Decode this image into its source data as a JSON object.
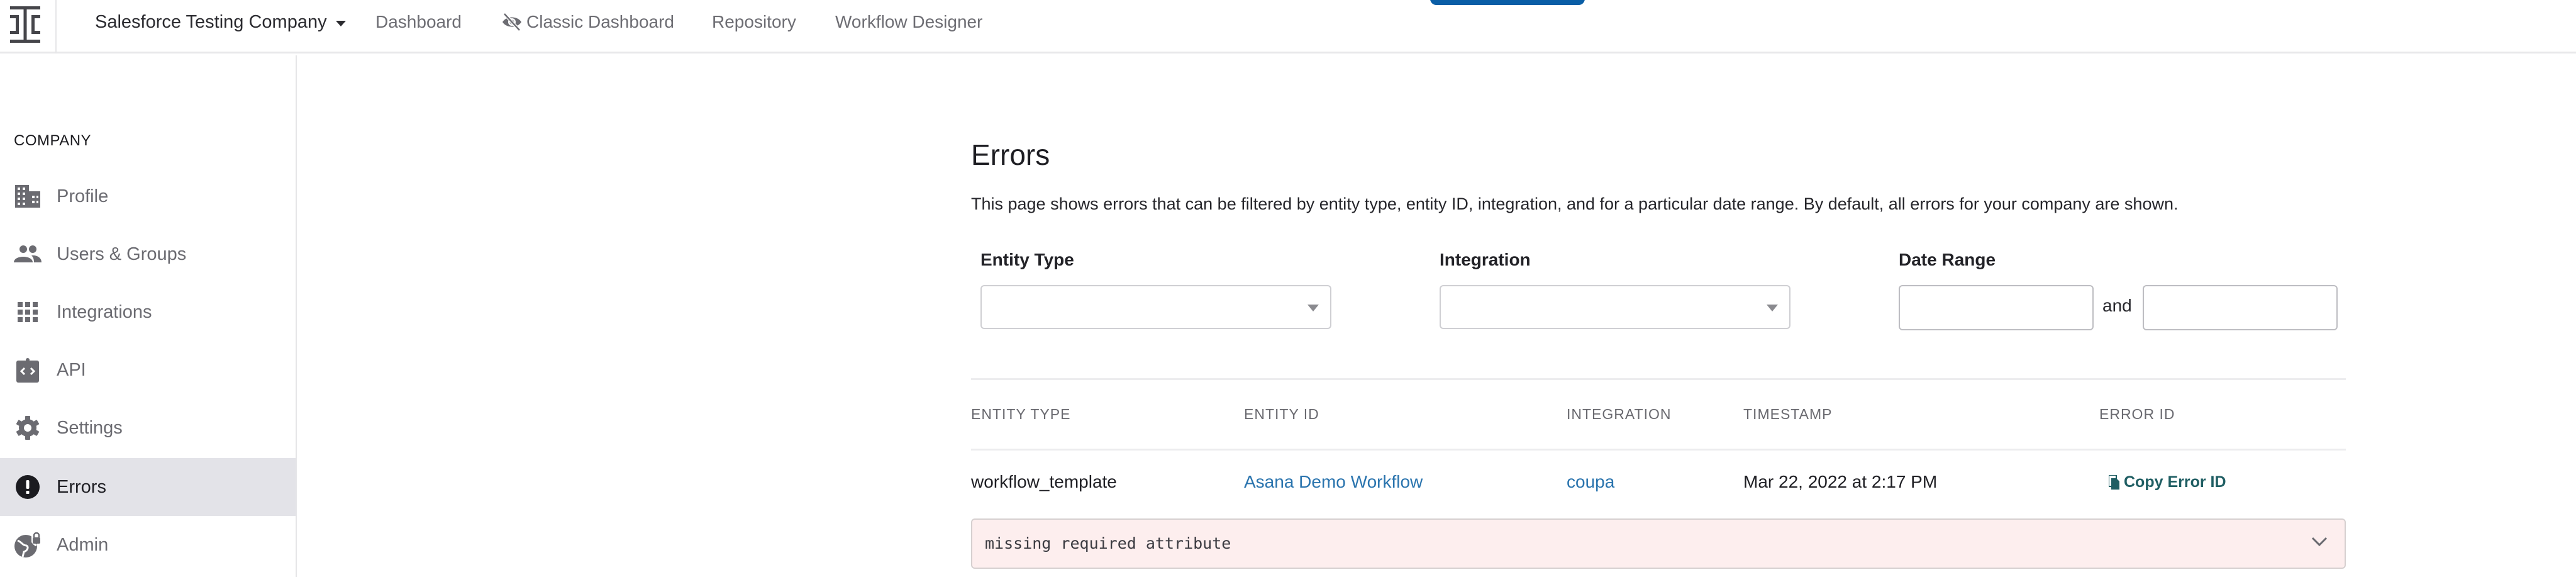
{
  "topnav": {
    "company_name": "Salesforce Testing Company",
    "links": [
      {
        "label": "Dashboard"
      },
      {
        "label": "Classic Dashboard",
        "icon": "eye-slash-icon"
      },
      {
        "label": "Repository"
      },
      {
        "label": "Workflow Designer"
      }
    ]
  },
  "sidebar": {
    "heading": "COMPANY",
    "items": [
      {
        "label": "Profile",
        "icon": "building-icon"
      },
      {
        "label": "Users & Groups",
        "icon": "users-icon"
      },
      {
        "label": "Integrations",
        "icon": "grid-icon"
      },
      {
        "label": "API",
        "icon": "code-clipboard-icon"
      },
      {
        "label": "Settings",
        "icon": "gear-icon"
      },
      {
        "label": "Errors",
        "icon": "exclamation-circle-icon",
        "active": true
      },
      {
        "label": "Admin",
        "icon": "globe-lock-icon"
      }
    ]
  },
  "main": {
    "title": "Errors",
    "description": "This page shows errors that can be filtered by entity type, entity ID, integration, and for a particular date range. By default, all errors for your company are shown.",
    "filters": {
      "entity_type_label": "Entity Type",
      "entity_type_value": "",
      "integration_label": "Integration",
      "integration_value": "",
      "date_range_label": "Date Range",
      "date_from": "",
      "date_joiner": "and",
      "date_to": ""
    },
    "table": {
      "columns": [
        "ENTITY TYPE",
        "ENTITY ID",
        "INTEGRATION",
        "TIMESTAMP",
        "ERROR ID"
      ],
      "rows": [
        {
          "entity_type": "workflow_template",
          "entity_id": "Asana Demo Workflow",
          "integration": "coupa",
          "timestamp": "Mar 22, 2022 at 2:17 PM",
          "error_id_action": "Copy Error ID",
          "error_message": "missing required attribute"
        }
      ]
    }
  },
  "colors": {
    "link": "#2a74ae",
    "copy_action": "#1f5e63",
    "error_bg": "#fdeeee",
    "active_sidebar_bg": "#e3e3e8",
    "primary_button": "#0a5ea6"
  }
}
